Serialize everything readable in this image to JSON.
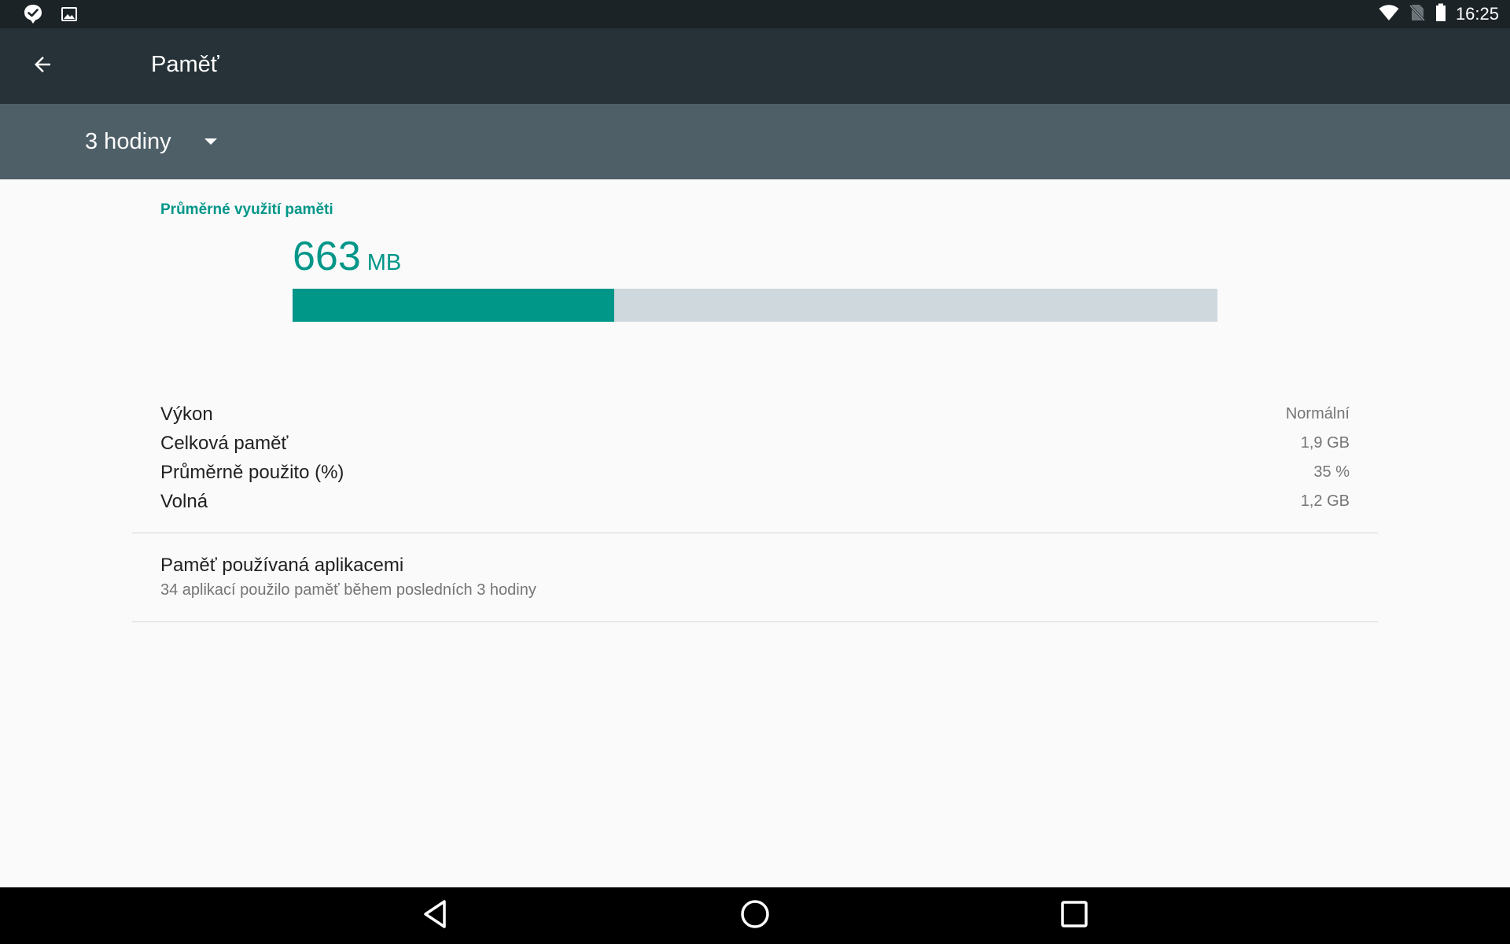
{
  "status_bar": {
    "time": "16:25",
    "left_icons": [
      "notification-check-icon",
      "image-icon"
    ],
    "right_icons": [
      "wifi-icon",
      "no-sim-icon",
      "battery-icon"
    ]
  },
  "toolbar": {
    "title": "Paměť",
    "back_icon": "arrow-back-icon"
  },
  "spinner": {
    "selected": "3 hodiny"
  },
  "memory": {
    "section_label": "Průměrné využití paměti",
    "value": "663",
    "unit": "MB",
    "used_fraction": 0.348,
    "bar_fill_color": "#009688",
    "bar_track_color": "#cfd8dc"
  },
  "stats": [
    {
      "label": "Výkon",
      "value": "Normální"
    },
    {
      "label": "Celková paměť",
      "value": "1,9 GB"
    },
    {
      "label": "Průměrně použito (%)",
      "value": "35 %"
    },
    {
      "label": "Volná",
      "value": "1,2 GB"
    }
  ],
  "apps_memory": {
    "title": "Paměť používaná aplikacemi",
    "subtitle": "34 aplikací použilo paměť během posledních 3 hodiny"
  },
  "nav_bar": {
    "buttons": [
      "back-icon",
      "home-icon",
      "recents-icon"
    ]
  },
  "colors": {
    "accent": "#009688",
    "toolbar": "#263238",
    "spinner_bar": "#4e5f68",
    "status_bar": "#1b2327"
  }
}
